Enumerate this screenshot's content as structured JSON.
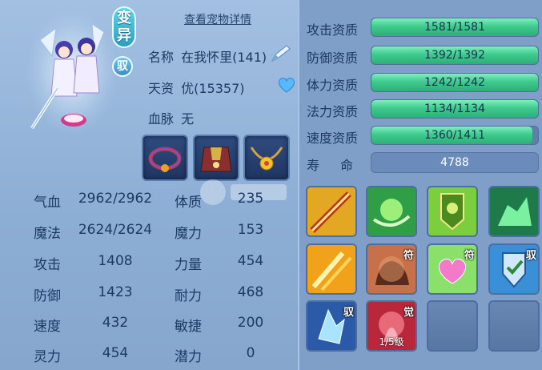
{
  "header": {
    "variant_badge": "变异",
    "yu_badge": "驭",
    "detail_link": "查看宠物详情"
  },
  "info": {
    "name_label": "名称",
    "name_value": "在我怀里(141)",
    "talent_label": "天资",
    "talent_value": "优(15357)",
    "blood_label": "血脉",
    "blood_value": "无"
  },
  "icons": {
    "edit": "pencil-icon",
    "heart": "heart-icon"
  },
  "equipment": [
    {
      "name": "collar-equipment"
    },
    {
      "name": "armor-equipment"
    },
    {
      "name": "necklace-equipment"
    }
  ],
  "stats": [
    {
      "label": "气血",
      "value": "2962/2962"
    },
    {
      "label": "魔法",
      "value": "2624/2624"
    },
    {
      "label": "攻击",
      "value": "1408"
    },
    {
      "label": "防御",
      "value": "1423"
    },
    {
      "label": "速度",
      "value": "432"
    },
    {
      "label": "灵力",
      "value": "454"
    }
  ],
  "attrs": [
    {
      "label": "体质",
      "value": "235"
    },
    {
      "label": "魔力",
      "value": "153"
    },
    {
      "label": "力量",
      "value": "454"
    },
    {
      "label": "耐力",
      "value": "468"
    },
    {
      "label": "敏捷",
      "value": "200"
    },
    {
      "label": "潜力",
      "value": "0"
    }
  ],
  "qualities": [
    {
      "label": "攻击资质",
      "value": "1581/1581",
      "fill": 1.0
    },
    {
      "label": "防御资质",
      "value": "1392/1392",
      "fill": 1.0
    },
    {
      "label": "体力资质",
      "value": "1242/1242",
      "fill": 1.0
    },
    {
      "label": "法力资质",
      "value": "1134/1134",
      "fill": 1.0
    },
    {
      "label": "速度资质",
      "value": "1360/1411",
      "fill": 0.964
    }
  ],
  "life": {
    "label": "寿命",
    "value": "4788"
  },
  "skills": [
    {
      "name": "skill-sword-strike",
      "tag": "",
      "level": ""
    },
    {
      "name": "skill-green-wind",
      "tag": "",
      "level": ""
    },
    {
      "name": "skill-green-shield-banner",
      "tag": "",
      "level": ""
    },
    {
      "name": "skill-green-beast",
      "tag": "",
      "level": ""
    },
    {
      "name": "skill-golden-blades",
      "tag": "",
      "level": ""
    },
    {
      "name": "skill-shadow-beast",
      "tag": "符",
      "level": ""
    },
    {
      "name": "skill-heart",
      "tag": "符",
      "level": ""
    },
    {
      "name": "skill-blue-shield",
      "tag": "驭",
      "level": ""
    },
    {
      "name": "skill-ice-crystal",
      "tag": "驭",
      "level": ""
    },
    {
      "name": "skill-red-spirit",
      "tag": "觉",
      "level": "1/5级"
    },
    {
      "name": "skill-empty-1",
      "tag": "",
      "level": ""
    },
    {
      "name": "skill-empty-2",
      "tag": "",
      "level": ""
    }
  ],
  "colors": {
    "bar_fill": "#3fca8e",
    "panel": "#9ab8dc",
    "text": "#1d3a63"
  }
}
